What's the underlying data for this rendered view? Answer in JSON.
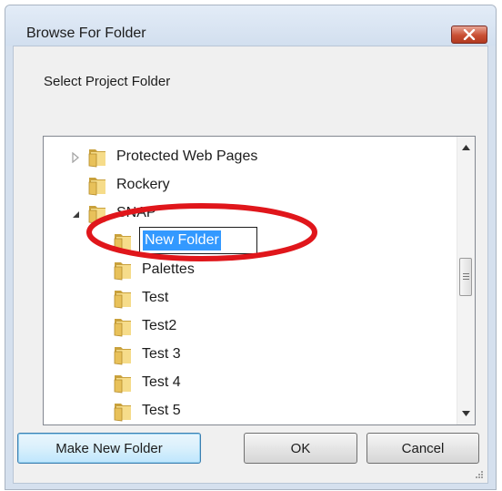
{
  "window": {
    "title": "Browse For Folder",
    "close_icon": "close-x-icon"
  },
  "prompt": "Select Project Folder",
  "tree": {
    "items": [
      {
        "label": "Protected Web Pages",
        "expander": "collapsed",
        "indent": 1
      },
      {
        "label": "Rockery",
        "expander": "none",
        "indent": 1
      },
      {
        "label": "SNAP",
        "expander": "expanded",
        "indent": 1
      },
      {
        "label": "New Folder",
        "expander": "none",
        "indent": 2,
        "editing": true
      },
      {
        "label": "Palettes",
        "expander": "none",
        "indent": 2
      },
      {
        "label": "Test",
        "expander": "none",
        "indent": 2
      },
      {
        "label": "Test2",
        "expander": "none",
        "indent": 2
      },
      {
        "label": "Test 3",
        "expander": "none",
        "indent": 2
      },
      {
        "label": "Test 4",
        "expander": "none",
        "indent": 2
      },
      {
        "label": "Test 5",
        "expander": "none",
        "indent": 2
      }
    ],
    "rename_value": "New Folder"
  },
  "buttons": {
    "make_new_folder": "Make New Folder",
    "ok": "OK",
    "cancel": "Cancel"
  },
  "annotation": {
    "shape": "ellipse",
    "color": "#e0161b"
  },
  "colors": {
    "selection": "#3399ff",
    "folder": "#e8c15a"
  }
}
